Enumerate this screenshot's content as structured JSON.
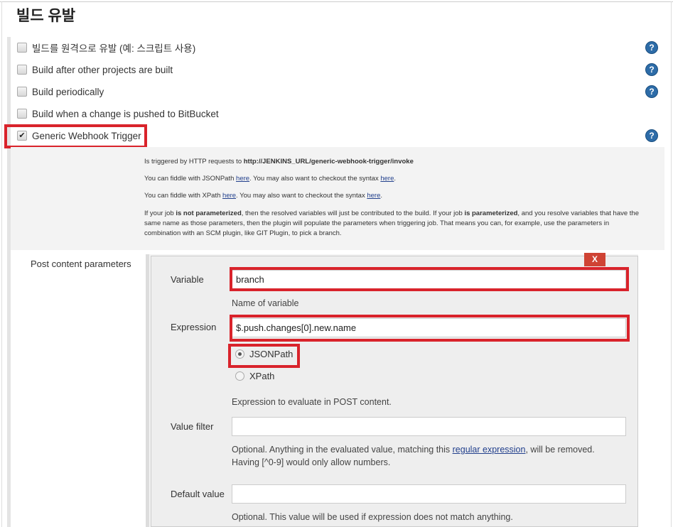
{
  "section_title": "빌드 유발",
  "triggers": [
    {
      "label": "빌드를 원격으로 유발 (예: 스크립트 사용)",
      "checked": false
    },
    {
      "label": "Build after other projects are built",
      "checked": false
    },
    {
      "label": "Build periodically",
      "checked": false
    },
    {
      "label": "Build when a change is pushed to BitBucket",
      "checked": false
    },
    {
      "label": "Generic Webhook Trigger",
      "checked": true
    }
  ],
  "help_glyph": "?",
  "checkmark": "✔",
  "description": {
    "l1_prefix": "Is triggered by HTTP requests to ",
    "l1_url": "http://JENKINS_URL/generic-webhook-trigger/invoke",
    "l2_a": "You can fiddle with JSONPath ",
    "l2_link1": "here",
    "l2_b": ". You may also want to checkout the syntax ",
    "l2_link2": "here",
    "l2_c": ".",
    "l3_a": "You can fiddle with XPath ",
    "l3_link1": "here",
    "l3_b": ". You may also want to checkout the syntax ",
    "l3_link2": "here",
    "l3_c": ".",
    "l4_a": "If your job ",
    "l4_b": "is not parameterized",
    "l4_c": ", then the resolved variables will just be contributed to the build. If your job ",
    "l4_d": "is parameterized",
    "l4_e": ", and you resolve variables that have the same name as those parameters, then the plugin will populate the parameters when triggering job. That means you can, for example, use the parameters in combination with an SCM plugin, like GIT Plugin, to pick a branch."
  },
  "post_content": {
    "label": "Post content parameters",
    "delete_label": "X",
    "variable_label": "Variable",
    "variable_value": "branch",
    "variable_hint": "Name of variable",
    "expression_label": "Expression",
    "expression_value": "$.push.changes[0].new.name",
    "radio_jsonpath": "JSONPath",
    "radio_xpath": "XPath",
    "selected": "JSONPath",
    "expression_hint": "Expression to evaluate in POST content.",
    "value_filter_label": "Value filter",
    "value_filter_value": "",
    "value_filter_hint_a": "Optional. Anything in the evaluated value, matching this ",
    "value_filter_hint_link": "regular expression",
    "value_filter_hint_b": ", will be removed. Having [^0-9] would only allow numbers.",
    "default_label": "Default value",
    "default_value": "",
    "default_hint": "Optional. This value will be used if expression does not match anything."
  }
}
